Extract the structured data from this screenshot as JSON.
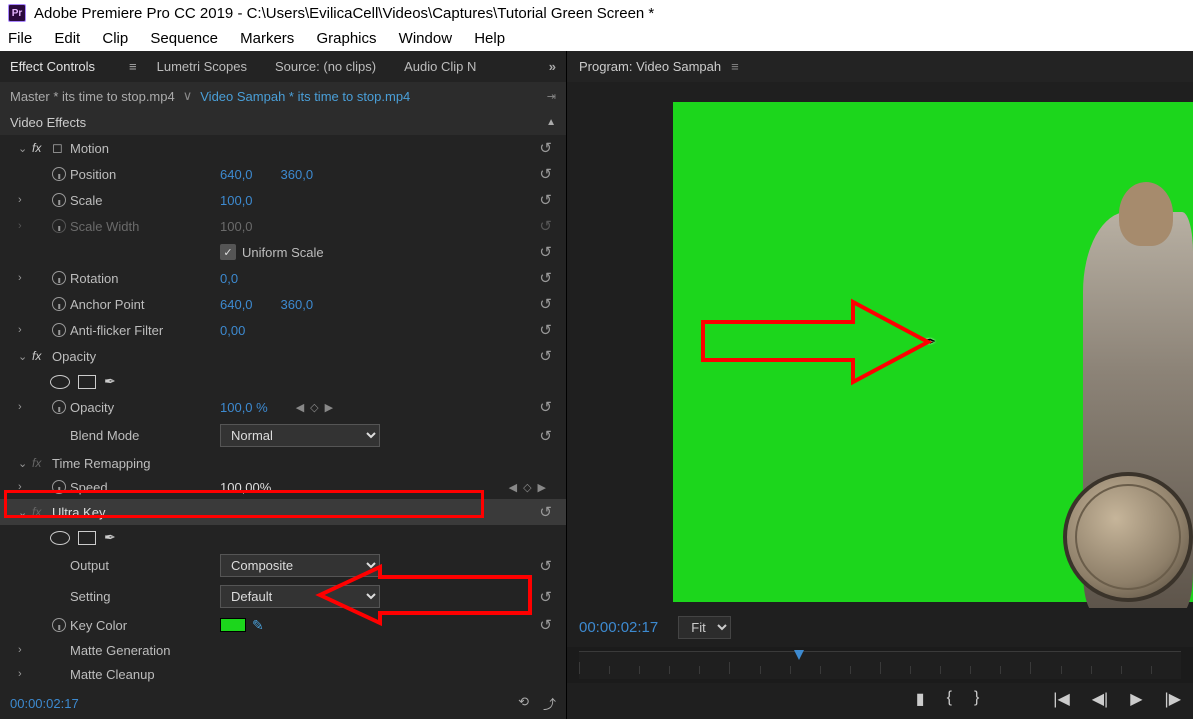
{
  "titlebar": {
    "app_badge": "Pr",
    "title": "Adobe Premiere Pro CC 2019 - C:\\Users\\EvilicaCell\\Videos\\Captures\\Tutorial Green Screen *"
  },
  "menubar": [
    "File",
    "Edit",
    "Clip",
    "Sequence",
    "Markers",
    "Graphics",
    "Window",
    "Help"
  ],
  "left_panel": {
    "tabs": {
      "effect_controls": "Effect Controls",
      "lumetri_scopes": "Lumetri Scopes",
      "source": "Source: (no clips)",
      "audio_clip": "Audio Clip N"
    },
    "master_bar": {
      "master": "Master * its time to stop.mp4",
      "link": "Video Sampah * its time to stop.mp4"
    },
    "section_video_effects": "Video Effects",
    "motion": {
      "title": "Motion",
      "position_label": "Position",
      "position_x": "640,0",
      "position_y": "360,0",
      "scale_label": "Scale",
      "scale_val": "100,0",
      "scalew_label": "Scale Width",
      "scalew_val": "100,0",
      "uniform_label": "Uniform Scale",
      "rotation_label": "Rotation",
      "rotation_val": "0,0",
      "anchor_label": "Anchor Point",
      "anchor_x": "640,0",
      "anchor_y": "360,0",
      "antiflicker_label": "Anti-flicker Filter",
      "antiflicker_val": "0,00"
    },
    "opacity": {
      "title": "Opacity",
      "opacity_label": "Opacity",
      "opacity_val": "100,0 %",
      "blend_label": "Blend Mode",
      "blend_val": "Normal"
    },
    "time_remap": {
      "title": "Time Remapping",
      "speed_label": "Speed",
      "speed_val": "100,00%"
    },
    "ultrakey": {
      "title": "Ultra Key",
      "output_label": "Output",
      "output_val": "Composite",
      "setting_label": "Setting",
      "setting_val": "Default",
      "keycolor_label": "Key Color",
      "matte_gen": "Matte Generation",
      "matte_clean": "Matte Cleanup"
    },
    "timecode": "00:00:02:17"
  },
  "program_panel": {
    "title": "Program: Video Sampah",
    "timecode": "00:00:02:17",
    "zoom": "Fit"
  }
}
